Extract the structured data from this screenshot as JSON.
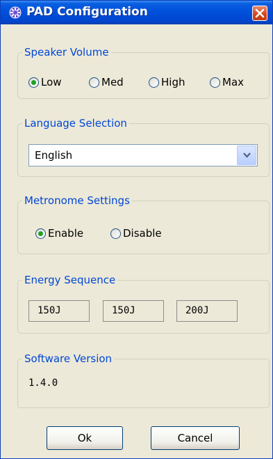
{
  "window": {
    "title": "PAD Configuration",
    "app_icon": "gear-icon",
    "close_icon": "close-icon"
  },
  "speaker_volume": {
    "legend": "Speaker Volume",
    "options": [
      {
        "label": "Low",
        "selected": true
      },
      {
        "label": "Med",
        "selected": false
      },
      {
        "label": "High",
        "selected": false
      },
      {
        "label": "Max",
        "selected": false
      }
    ]
  },
  "language": {
    "legend": "Language Selection",
    "selected": "English"
  },
  "metronome": {
    "legend": "Metronome Settings",
    "options": [
      {
        "label": "Enable",
        "selected": true
      },
      {
        "label": "Disable",
        "selected": false
      }
    ]
  },
  "energy": {
    "legend": "Energy Sequence",
    "values": [
      "150J",
      "150J",
      "200J"
    ]
  },
  "software": {
    "legend": "Software Version",
    "version": "1.4.0"
  },
  "buttons": {
    "ok": "Ok",
    "cancel": "Cancel"
  },
  "colors": {
    "titlebar": "#0050dc",
    "legend_text": "#0046d5",
    "dialog_bg": "#ece9d8",
    "radio_selected": "#21a121",
    "close_button": "#d44318"
  }
}
